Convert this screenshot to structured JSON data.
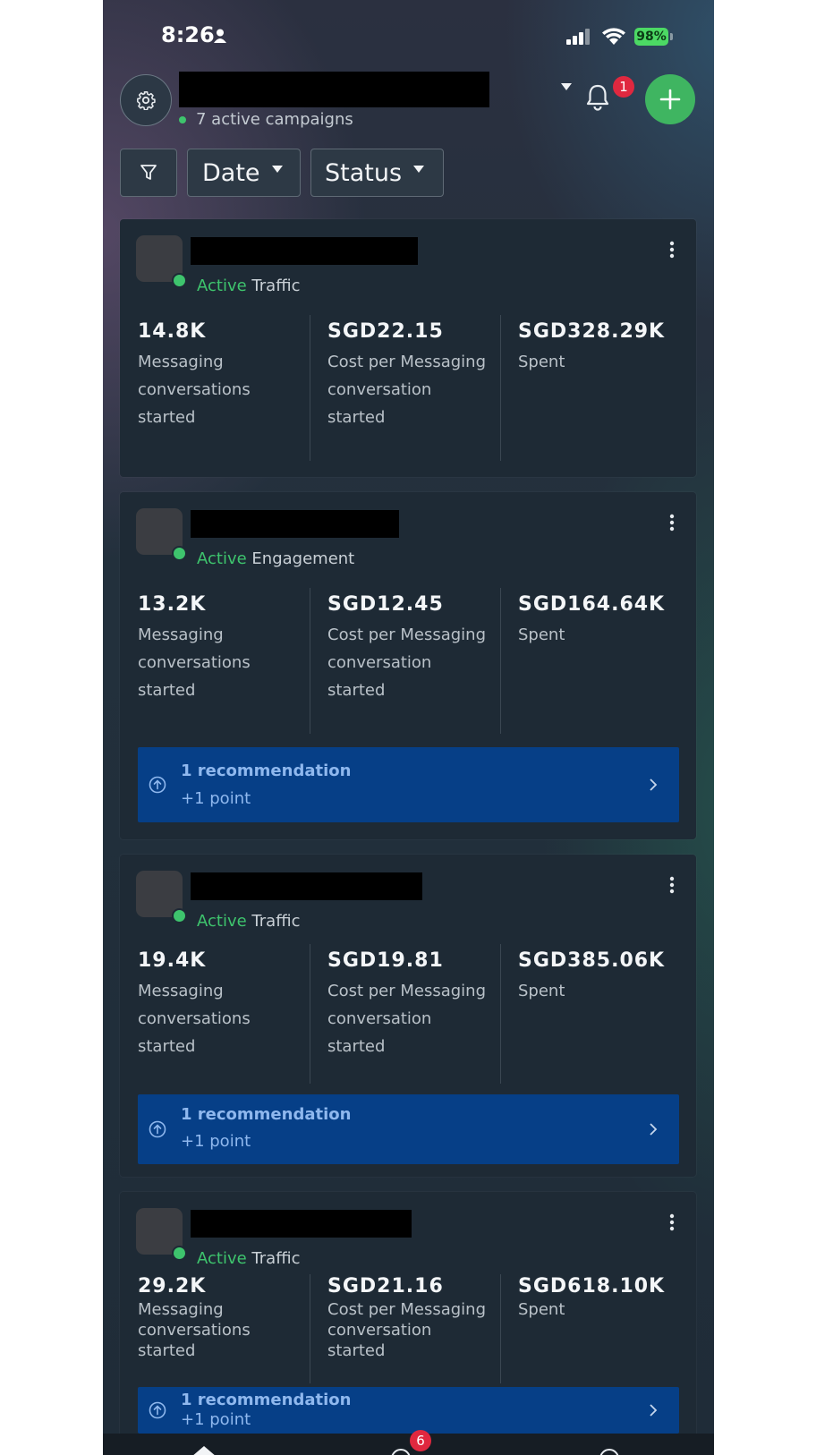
{
  "status_bar": {
    "time": "8:26",
    "battery": "98%"
  },
  "header": {
    "active_campaigns": "7 active campaigns",
    "notification_count": "1"
  },
  "filters": {
    "date_label": "Date",
    "status_label": "Status"
  },
  "campaigns": [
    {
      "status": "Active",
      "objective": "Traffic",
      "results_value": "14.8K",
      "results_label": "Messaging conversations started",
      "cost_value": "SGD22.15",
      "cost_label": "Cost per Messaging conversation started",
      "spent_value": "SGD328.29K",
      "spent_label": "Spent"
    },
    {
      "status": "Active",
      "objective": "Engagement",
      "results_value": "13.2K",
      "results_label": "Messaging conversations started",
      "cost_value": "SGD12.45",
      "cost_label": "Cost per Messaging conversation started",
      "spent_value": "SGD164.64K",
      "spent_label": "Spent",
      "recommendation_title": "1 recommendation",
      "recommendation_points": "+1 point"
    },
    {
      "status": "Active",
      "objective": "Traffic",
      "results_value": "19.4K",
      "results_label": "Messaging conversations started",
      "cost_value": "SGD19.81",
      "cost_label": "Cost per Messaging conversation started",
      "spent_value": "SGD385.06K",
      "spent_label": "Spent",
      "recommendation_title": "1 recommendation",
      "recommendation_points": "+1 point"
    },
    {
      "status": "Active",
      "objective": "Traffic",
      "results_value": "29.2K",
      "results_label": "Messaging conversations started",
      "cost_value": "SGD21.16",
      "cost_label": "Cost per Messaging conversation started",
      "spent_value": "SGD618.10K",
      "spent_label": "Spent",
      "recommendation_title": "1 recommendation",
      "recommendation_points": "+1 point"
    }
  ],
  "tab_bar": {
    "badge_count": "6"
  }
}
